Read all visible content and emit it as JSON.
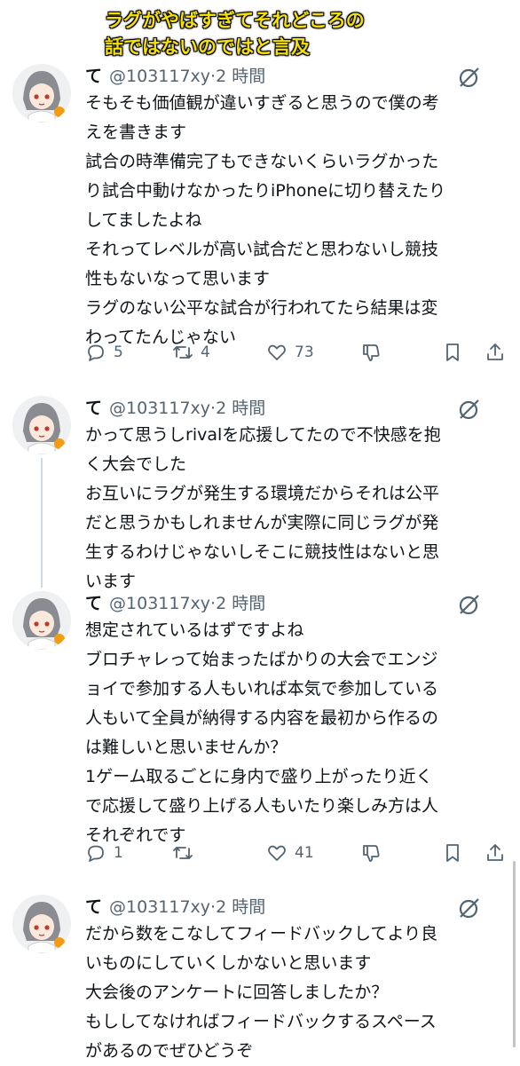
{
  "caption": [
    "ラグがやばすぎてそれどころの",
    "話ではないのではと言及"
  ],
  "tweets": [
    {
      "name": "て",
      "handle": "@103117xy",
      "time": "2 時間",
      "lines": [
        "そもそも価値観が違いすぎると思うので僕の考",
        "えを書きます",
        "試合の時準備完了もできないくらいラグかった",
        "り試合中動けなかったりiPhoneに切り替えたり",
        "してましたよね",
        "それってレベルが高い試合だと思わないし競技",
        "性もないなって思います",
        "ラグのない公平な試合が行われてたら結果は変",
        "わってたんじゃない"
      ],
      "replies": "5",
      "retweets": "4",
      "likes": "73"
    },
    {
      "name": "て",
      "handle": "@103117xy",
      "time": "2 時間",
      "lines": [
        "かって思うしrivalを応援してたので不快感を抱",
        "く大会でした",
        "お互いにラグが発生する環境だからそれは公平",
        "だと思うかもしれませんが実際に同じラグが発",
        "生するわけじゃないしそこに競技性はないと思",
        "います"
      ]
    },
    {
      "name": "て",
      "handle": "@103117xy",
      "time": "2 時間",
      "lines": [
        "想定されているはずですよね",
        "ブロチャレって始まったばかりの大会でエンジ",
        "ョイで参加する人もいれば本気で参加している",
        "人もいて全員が納得する内容を最初から作るの",
        "は難しいと思いませんか？",
        "1ゲーム取るごとに身内で盛り上がったり近く",
        "で応援して盛り上げる人もいたり楽しみ方は人",
        "それぞれです"
      ],
      "replies": "1",
      "retweets": "",
      "likes": "41"
    },
    {
      "name": "て",
      "handle": "@103117xy",
      "time": "2 時間",
      "lines": [
        "だから数をこなしてフィードバックしてより良",
        "いものにしていくしかないと思います",
        "大会後のアンケートに回答しましたか？",
        "もししてなければフィードバックするスペース",
        "があるのでぜひどうぞ"
      ]
    }
  ]
}
